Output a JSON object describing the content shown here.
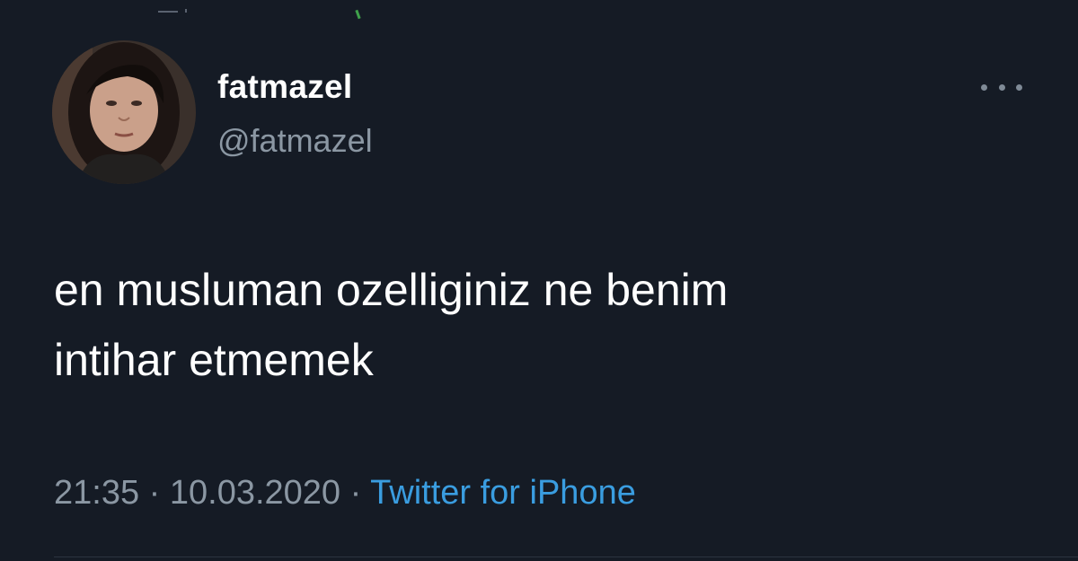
{
  "tweet": {
    "display_name": "fatmazel",
    "handle": "@fatmazel",
    "text": "en musluman ozelliginiz ne benim\nintihar etmemek",
    "time": "21:35",
    "date": "10.03.2020",
    "separator": "·",
    "source": "Twitter for iPhone",
    "more_icon": "more-horizontal-icon",
    "avatar_icon": "profile-photo"
  },
  "colors": {
    "background": "#151b25",
    "text": "#ffffff",
    "secondary_text": "#8b97a3",
    "link": "#3a9de0"
  }
}
